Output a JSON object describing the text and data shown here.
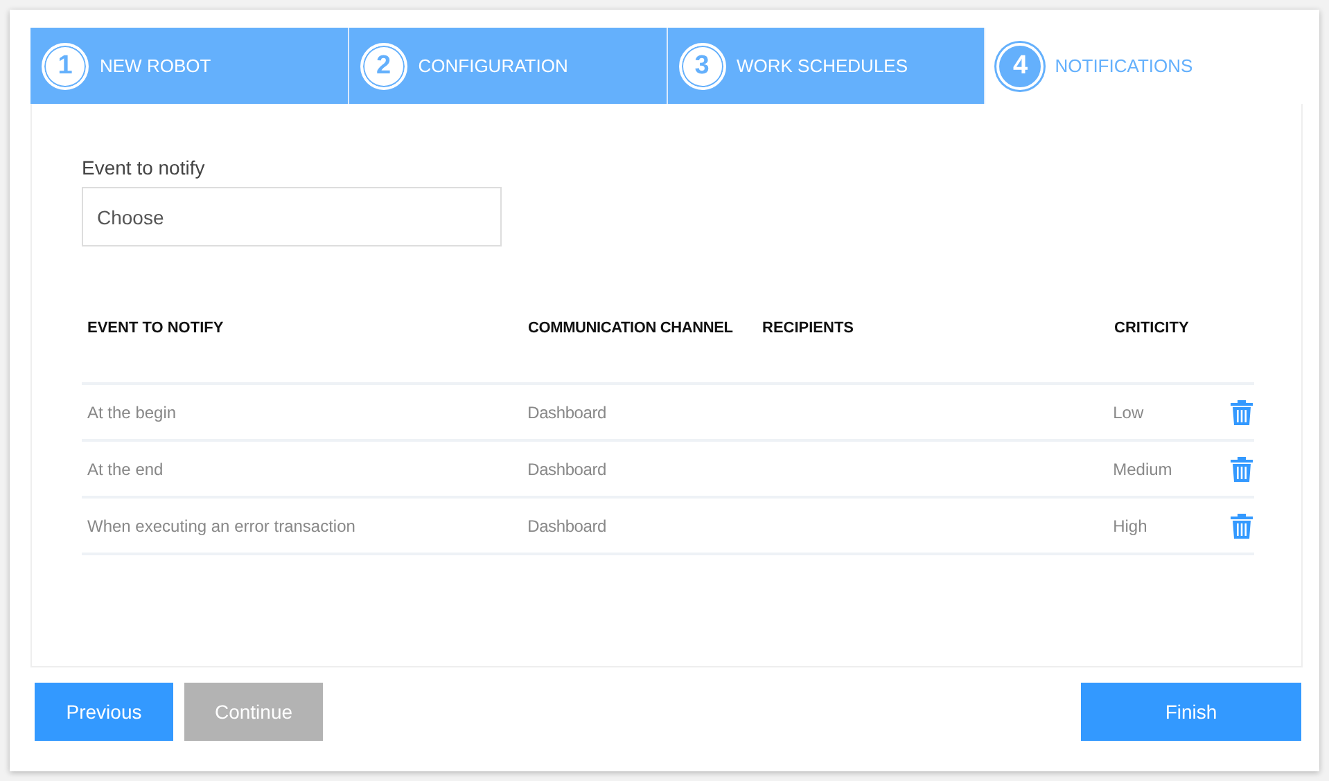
{
  "steps": [
    {
      "number": "1",
      "label": "NEW ROBOT",
      "selected": false
    },
    {
      "number": "2",
      "label": "CONFIGURATION",
      "selected": false
    },
    {
      "number": "3",
      "label": "WORK SCHEDULES",
      "selected": false
    },
    {
      "number": "4",
      "label": "NOTIFICATIONS",
      "selected": true
    }
  ],
  "event_field": {
    "label": "Event to notify",
    "placeholder": "Choose"
  },
  "table": {
    "columns": [
      "EVENT TO NOTIFY",
      "COMMUNICATION CHANNEL",
      "RECIPIENTS",
      "CRITICITY"
    ],
    "rows": [
      {
        "event": "At the begin",
        "channel": "Dashboard",
        "criticity": "Low"
      },
      {
        "event": "At the end",
        "channel": "Dashboard",
        "criticity": "Medium"
      },
      {
        "event": "When executing an error transaction",
        "channel": "Dashboard",
        "criticity": "High"
      }
    ]
  },
  "buttons": [
    {
      "label": "Previous",
      "disabled": false
    },
    {
      "label": "Continue",
      "disabled": true
    },
    {
      "label": "Finish",
      "disabled": false
    }
  ]
}
